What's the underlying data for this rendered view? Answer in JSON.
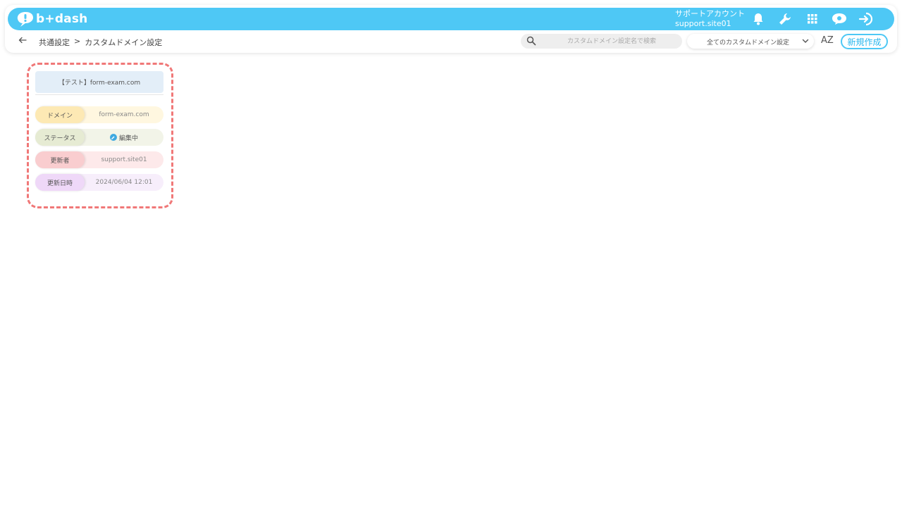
{
  "app": {
    "logo_text": "b+dash"
  },
  "account": {
    "label": "サポートアカウント",
    "user": "support.site01"
  },
  "icons": [
    "bell-icon",
    "wrench-icon",
    "grid-icon",
    "chat-icon",
    "logout-icon"
  ],
  "breadcrumb": {
    "parent": "共通設定",
    "separator": ">",
    "current": "カスタムドメイン設定"
  },
  "search": {
    "placeholder": "カスタムドメイン設定名で検索"
  },
  "filter": {
    "selected": "全てのカスタムドメイン設定"
  },
  "toolbar": {
    "sort_label": "AZ",
    "new_label": "新規作成"
  },
  "card": {
    "title": "【テスト】form-exam.com",
    "rows": [
      {
        "label": "ドメイン",
        "value": "form-exam.com"
      },
      {
        "label": "ステータス",
        "value": "編集中"
      },
      {
        "label": "更新者",
        "value": "support.site01"
      },
      {
        "label": "更新日時",
        "value": "2024/06/04 12:01"
      }
    ]
  },
  "colors": {
    "brand": "#4ec8f5",
    "highlight": "#f07878"
  }
}
